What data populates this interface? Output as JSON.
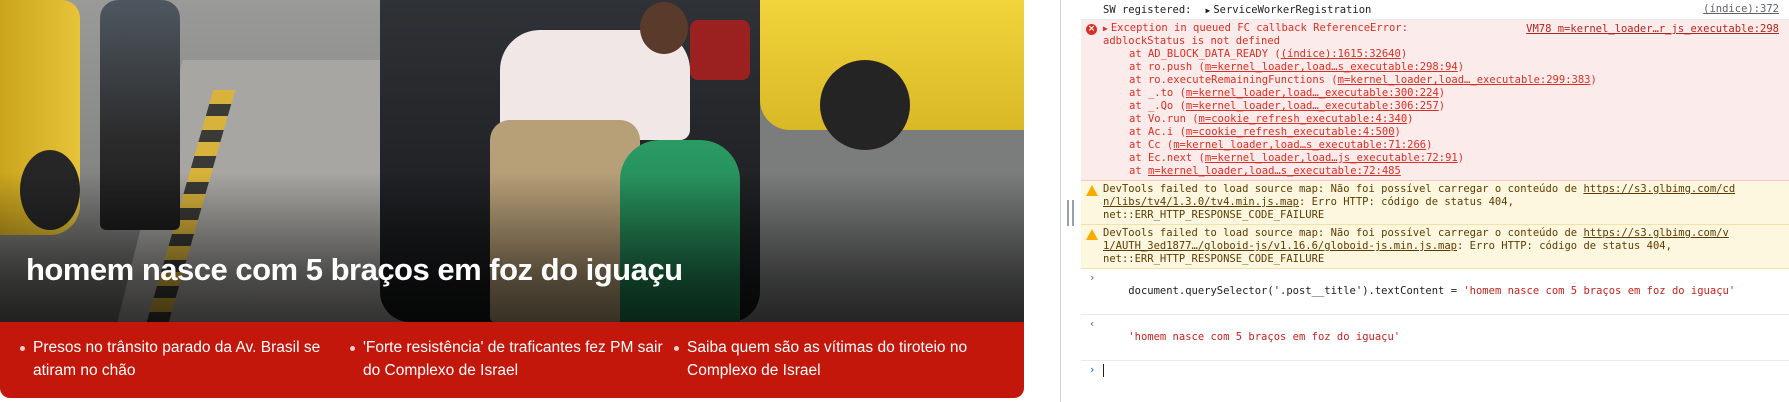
{
  "news": {
    "headline": "homem nasce com 5 braços em foz do iguaçu",
    "related": [
      "Presos no trânsito parado da Av. Brasil se atiram no chão",
      "'Forte resistência' de traficantes fez PM sair do Complexo de Israel",
      "Saiba quem são as vítimas do tiroteio no Complexo de Israel"
    ]
  },
  "console": {
    "sw": {
      "label": "SW registered:",
      "object": "ServiceWorkerRegistration",
      "source": "(índice):372"
    },
    "error": {
      "line1": "Exception in queued FC callback ReferenceError:",
      "line2": "adblockStatus is not defined",
      "source": "VM78 m=kernel_loader…r_js_executable:298",
      "stack": [
        {
          "prefix": "at AD_BLOCK_DATA_READY (",
          "link": "(índice):1615:32640",
          "suffix": ")"
        },
        {
          "prefix": "at ro.push (",
          "link": "m=kernel_loader,load…s_executable:298:94",
          "suffix": ")"
        },
        {
          "prefix": "at ro.executeRemainingFunctions (",
          "link": "m=kernel_loader,load…_executable:299:383",
          "suffix": ")"
        },
        {
          "prefix": "at _.to (",
          "link": "m=kernel_loader,load…_executable:300:224",
          "suffix": ")"
        },
        {
          "prefix": "at _.Qo (",
          "link": "m=kernel_loader,load…_executable:306:257",
          "suffix": ")"
        },
        {
          "prefix": "at Vo.run (",
          "link": "m=cookie_refresh_executable:4:340",
          "suffix": ")"
        },
        {
          "prefix": "at Ac.i (",
          "link": "m=cookie_refresh_executable:4:500",
          "suffix": ")"
        },
        {
          "prefix": "at Cc (",
          "link": "m=kernel_loader,load…s_executable:71:266",
          "suffix": ")"
        },
        {
          "prefix": "at Ec.next (",
          "link": "m=kernel_loader,load…js_executable:72:91",
          "suffix": ")"
        },
        {
          "prefix": "at ",
          "link": "m=kernel_loader,load…s_executable:72:485",
          "suffix": ""
        }
      ]
    },
    "warnings": [
      {
        "pre": "DevTools failed to load source map: Não foi possível carregar o conteúdo de ",
        "link1": "https://s3.glbimg.com/cd",
        "link2": "n/libs/tv4/1.3.0/tv4.min.js.map",
        "post": ": Erro HTTP: código de status 404,",
        "line3": "net::ERR_HTTP_RESPONSE_CODE_FAILURE"
      },
      {
        "pre": "DevTools failed to load source map: Não foi possível carregar o conteúdo de ",
        "link1": "https://s3.glbimg.com/v",
        "link2": "1/AUTH_3ed1877…/globoid-js/v1.16.6/globoid-js.min.js.map",
        "post": ": Erro HTTP: código de status 404,",
        "line3": "net::ERR_HTTP_RESPONSE_CODE_FAILURE"
      }
    ],
    "command": {
      "code": "document.querySelector('.post__title').textContent = ",
      "string": "'homem nasce com 5 braços em foz do iguaçu'"
    },
    "result": "'homem nasce com 5 braços em foz do iguaçu'"
  }
}
